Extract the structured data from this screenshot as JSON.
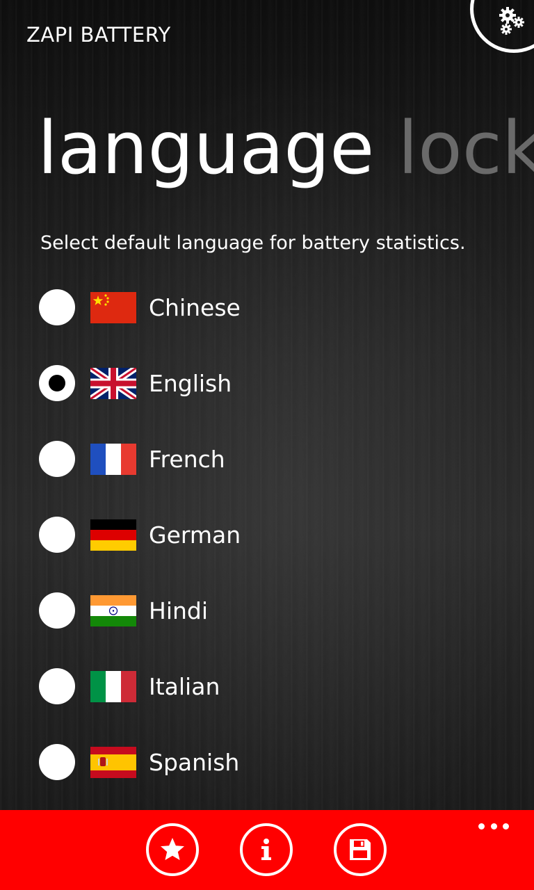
{
  "app": {
    "title": "ZAPI BATTERY"
  },
  "pivot": {
    "headers": [
      {
        "label": "language",
        "active": true
      },
      {
        "label": "lock",
        "active": false
      }
    ]
  },
  "instruction": "Select default language for battery statistics.",
  "languages": [
    {
      "label": "Chinese",
      "flag": "china-flag-icon",
      "selected": false
    },
    {
      "label": "English",
      "flag": "uk-flag-icon",
      "selected": true
    },
    {
      "label": "French",
      "flag": "france-flag-icon",
      "selected": false
    },
    {
      "label": "German",
      "flag": "germany-flag-icon",
      "selected": false
    },
    {
      "label": "Hindi",
      "flag": "india-flag-icon",
      "selected": false
    },
    {
      "label": "Italian",
      "flag": "italy-flag-icon",
      "selected": false
    },
    {
      "label": "Spanish",
      "flag": "spain-flag-icon",
      "selected": false
    }
  ],
  "app_bar": {
    "buttons": [
      {
        "icon": "star-icon"
      },
      {
        "icon": "info-icon"
      },
      {
        "icon": "save-icon"
      }
    ],
    "more_icon": "more-icon"
  },
  "colors": {
    "app_bar": "#ff0000",
    "inactive_header": "#6a6a6a",
    "text": "#ffffff"
  }
}
